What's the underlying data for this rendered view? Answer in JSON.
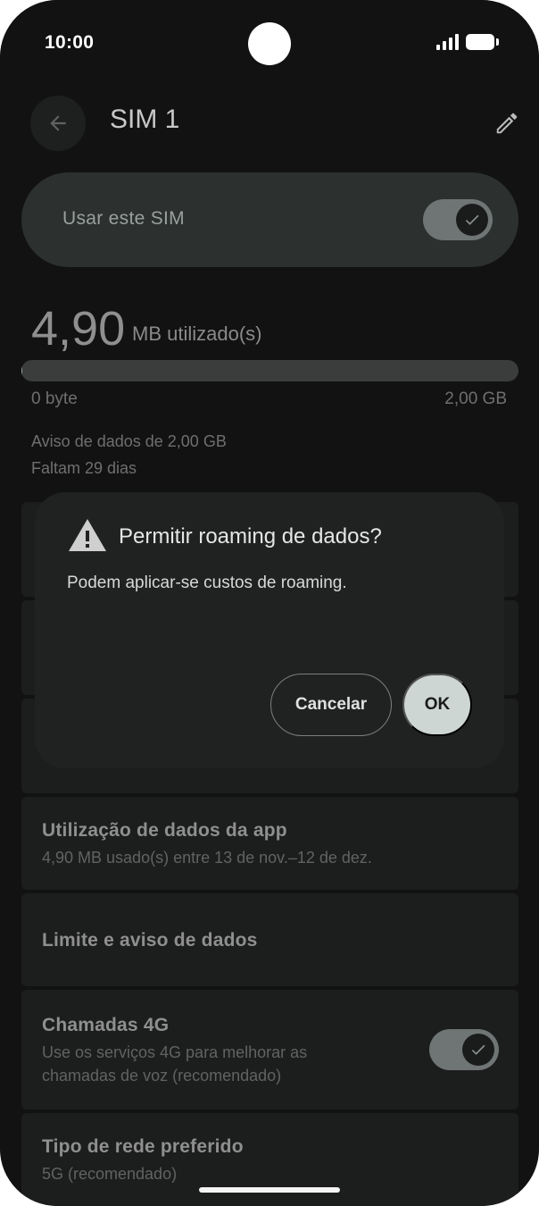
{
  "status_bar": {
    "time": "10:00"
  },
  "header": {
    "title": "SIM 1"
  },
  "use_sim": {
    "label": "Usar este SIM",
    "enabled": true
  },
  "usage": {
    "amount": "4,90",
    "unit": "MB utilizado(s)",
    "bar_min": "0 byte",
    "bar_max": "2,00 GB",
    "fill_fraction": 0.0024,
    "warning": "Aviso de dados de 2,00 GB",
    "days_left": "Faltam 29 dias"
  },
  "list": {
    "app_data": {
      "title": "Utilização de dados da app",
      "subtitle": "4,90 MB usado(s) entre 13 de nov.–12 de dez."
    },
    "limit": {
      "title": "Limite e aviso de dados"
    },
    "calls_4g": {
      "title": "Chamadas 4G",
      "subtitle_line1": "Use os serviços 4G para melhorar as",
      "subtitle_line2": "chamadas de voz (recomendado)",
      "enabled": true
    },
    "network_type": {
      "title": "Tipo de rede preferido",
      "subtitle": "5G (recomendado)"
    }
  },
  "dialog": {
    "title": "Permitir roaming de dados?",
    "body": "Podem aplicar-se custos de roaming.",
    "cancel_label": "Cancelar",
    "ok_label": "OK"
  },
  "colors": {
    "accent": "#cdd6d2",
    "background": "#121212",
    "dialog": "#202222"
  },
  "icons": [
    "back-arrow-icon",
    "edit-pencil-icon",
    "check-icon",
    "warning-icon",
    "signal-icon",
    "battery-icon"
  ]
}
